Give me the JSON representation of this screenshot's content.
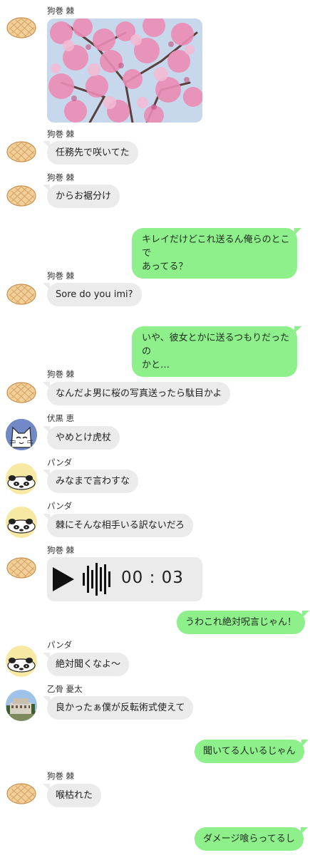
{
  "colors": {
    "incoming_bubble": "#ebebeb",
    "outgoing_bubble": "#8ef08b"
  },
  "icons": {
    "melon_pan_avatar": "melon-pan-icon",
    "white_cat_avatar": "white-cat-icon",
    "panda_avatar": "panda-icon",
    "building_avatar": "building-photo-icon",
    "play": "play-icon",
    "waveform": "waveform-icon"
  },
  "messages": [
    {
      "sender": "狗巻 棘",
      "type": "image",
      "alt": "桜"
    },
    {
      "sender": "狗巻 棘",
      "text": "任務先で咲いてた"
    },
    {
      "sender": "狗巻 棘",
      "text": "からお裾分け"
    },
    {
      "sender": "me",
      "text": "キレイだけどこれ送るん俺らのとこで\nあってる？"
    },
    {
      "sender": "狗巻 棘",
      "text": "Sore do you imi?"
    },
    {
      "sender": "me",
      "text": "いや、彼女とかに送るつもりだったの\nかと…"
    },
    {
      "sender": "狗巻 棘",
      "text": "なんだよ男に桜の写真送ったら駄目かよ"
    },
    {
      "sender": "伏黒 恵",
      "text": "やめとけ虎杖"
    },
    {
      "sender": "パンダ",
      "text": "みなまで言わすな"
    },
    {
      "sender": "パンダ",
      "text": "棘にそんな相手いる訳ないだろ"
    },
    {
      "sender": "狗巻 棘",
      "type": "voice",
      "duration": "00 : 03"
    },
    {
      "sender": "me",
      "text": "うわこれ絶対呪言じゃん！"
    },
    {
      "sender": "パンダ",
      "text": "絶対聞くなよ〜"
    },
    {
      "sender": "乙骨 憂太",
      "text": "良かったぁ僕が反転術式使えて"
    },
    {
      "sender": "me",
      "text": "聞いてる人いるじゃん"
    },
    {
      "sender": "狗巻 棘",
      "text": "喉枯れた"
    },
    {
      "sender": "me",
      "text": "ダメージ喰らってるし"
    }
  ]
}
